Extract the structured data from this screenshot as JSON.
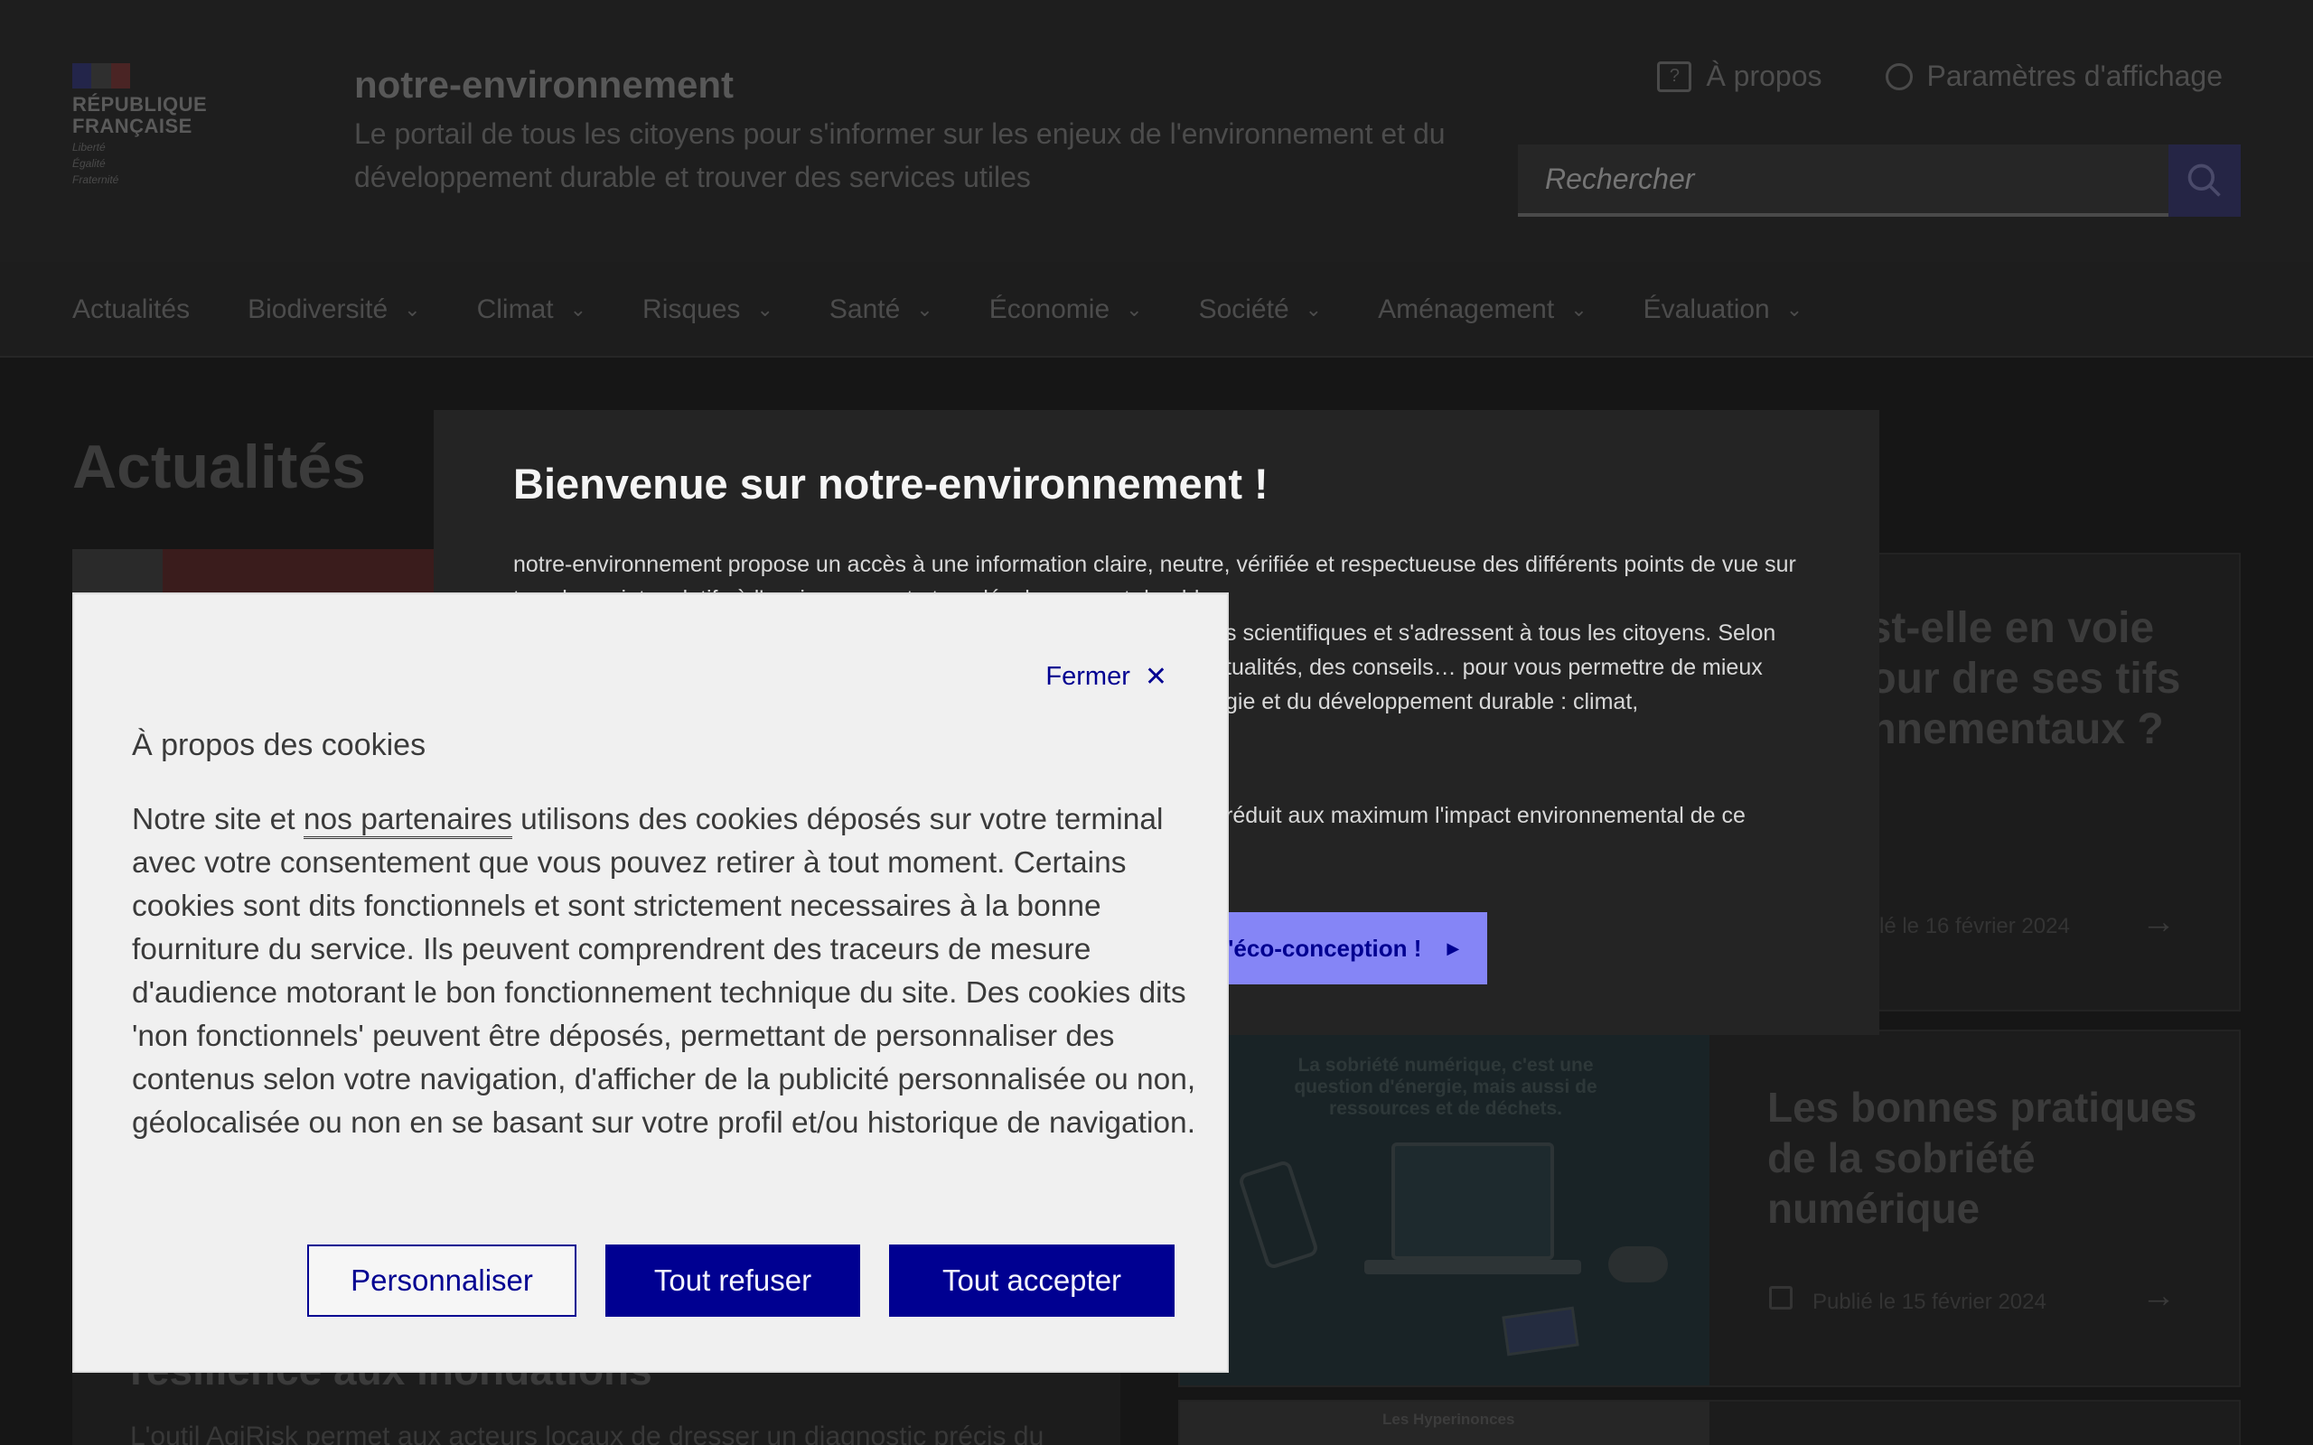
{
  "header": {
    "logo_line1": "RÉPUBLIQUE",
    "logo_line2": "FRANÇAISE",
    "motto_line1": "Liberté",
    "motto_line2": "Égalité",
    "motto_line3": "Fraternité",
    "site_title": "notre-environnement",
    "tagline": "Le portail de tous les citoyens pour s'informer sur les enjeux de l'environnement et du développement durable et trouver des services utiles",
    "about_link": "À propos",
    "display_settings_link": "Paramètres d'affichage",
    "search_placeholder": "Rechercher"
  },
  "nav": {
    "items": [
      {
        "label": "Actualités"
      },
      {
        "label": "Biodiversité"
      },
      {
        "label": "Climat"
      },
      {
        "label": "Risques"
      },
      {
        "label": "Santé"
      },
      {
        "label": "Économie"
      },
      {
        "label": "Société"
      },
      {
        "label": "Aménagement"
      },
      {
        "label": "Évaluation"
      }
    ]
  },
  "page": {
    "heading": "Actualités",
    "card1_title": "est-elle en voie pour dre ses tifs onnementaux ?",
    "card1_date": "lé le 16 février 2024",
    "card2_image_text": "La sobriété numérique, c'est une question d'énergie, mais aussi de ressources et de déchets.",
    "card2_title": "Les bonnes pratiques de la sobriété numérique",
    "card2_date": "Publié le 15 février 2024",
    "card3_image_text": "Les Hyperinonces",
    "left_card_title": "résilience aux inondations",
    "left_card_desc": "L'outil AgiRisk permet aux acteurs locaux de dresser un diagnostic précis du"
  },
  "welcome": {
    "title": "Bienvenue sur notre-environnement !",
    "p1": "notre-environnement propose un accès à une information claire, neutre, vérifiée et respectueuse des différents points de vue sur tous les sujets relatifs à l'environnement et au développement durable.",
    "p2": "s scientifiques et s'adressent à tous les citoyens. Selon",
    "p3": "tualités, des conseils… pour vous permettre de mieux",
    "p4": "gie et du développement durable : climat,",
    "p5": "réduit aux maximum l'impact environnemental de ce",
    "eco_button": "l'éco-conception !"
  },
  "cookie": {
    "close_label": "Fermer",
    "title": "À propos des cookies",
    "body_pre": "Notre site et ",
    "partners_link": "nos partenaires",
    "body_post": " utilisons des cookies déposés sur votre terminal avec votre consentement que vous pouvez retirer à tout moment. Certains cookies sont dits fonctionnels et sont strictement necessaires à la bonne fourniture du service. Ils peuvent comprendrent des traceurs de mesure d'audience motorant le bon fonctionnement technique du site. Des cookies dits 'non fonctionnels' peuvent être déposés, permettant de personnaliser des contenus selon votre navigation, d'afficher de la publicité personnalisée ou non, géolocalisée ou non en se basant sur votre profil et/ou historique de navigation.",
    "customize_button": "Personnaliser",
    "refuse_button": "Tout refuser",
    "accept_button": "Tout accepter"
  },
  "colors": {
    "primary_blue": "#000091",
    "modal_bg": "#f0f0f0",
    "eco_button_bg": "#8585f6"
  }
}
